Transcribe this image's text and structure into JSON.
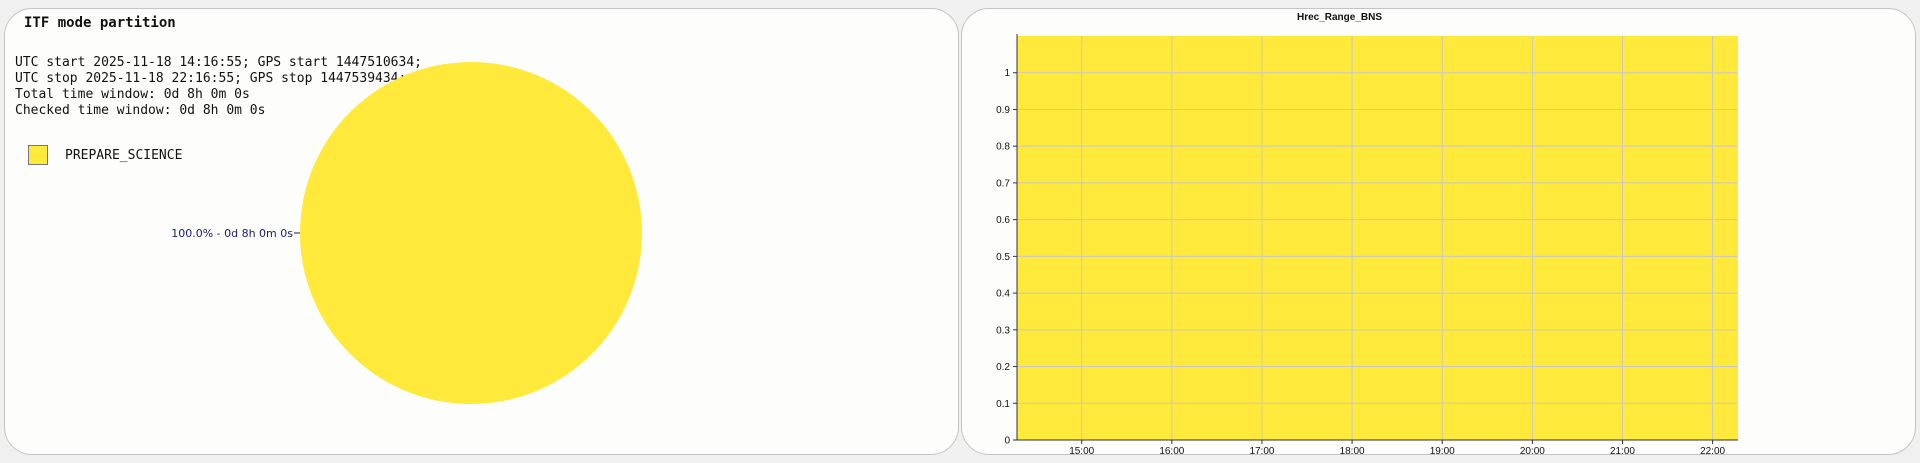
{
  "colors": {
    "prepare_science": "#ffe93b",
    "grid": "#c8c8c8"
  },
  "itf": {
    "title": "ITF mode partition",
    "info_lines": [
      "UTC start 2025-11-18 14:16:55; GPS start 1447510634;",
      "UTC stop 2025-11-18 22:16:55; GPS stop 1447539434;",
      "Total time window: 0d 8h 0m 0s",
      "Checked time window: 0d 8h 0m 0s"
    ],
    "legend": [
      {
        "label": "PREPARE_SCIENCE"
      }
    ]
  },
  "chart_data": [
    {
      "type": "pie",
      "slices": [
        {
          "label": "PREPARE_SCIENCE",
          "value": 100.0,
          "annotation": "100.0% - 0d 8h 0m 0s"
        }
      ]
    },
    {
      "type": "area",
      "title": "Hrec_Range_BNS",
      "xlabel": "",
      "ylabel": "",
      "x": [
        "14:16:55",
        "22:16:55"
      ],
      "xlim": [
        "14:16:55",
        "22:16:55"
      ],
      "ylim": [
        0,
        1.1
      ],
      "x_ticks": [
        "15:00",
        "16:00",
        "17:00",
        "18:00",
        "19:00",
        "20:00",
        "21:00",
        "22:00"
      ],
      "y_ticks": [
        "0",
        "0.1",
        "0.2",
        "0.3",
        "0.4",
        "0.5",
        "0.6",
        "0.7",
        "0.8",
        "0.9",
        "1"
      ],
      "series": [
        {
          "values": [
            1.1,
            1.1
          ]
        }
      ],
      "grid": true
    }
  ]
}
